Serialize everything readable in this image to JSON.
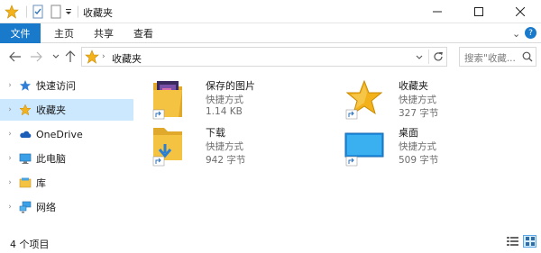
{
  "window": {
    "title": "收藏夹",
    "controls": [
      "minimize",
      "maximize",
      "close"
    ]
  },
  "ribbon": {
    "file_tab": "文件",
    "tabs": [
      "主页",
      "共享",
      "查看"
    ],
    "expand_label": "⌄",
    "help_label": "?"
  },
  "address": {
    "path": "收藏夹",
    "search_placeholder": "搜索\"收藏..."
  },
  "nav": {
    "items": [
      {
        "label": "快速访问",
        "icon": "quick-access-star-icon"
      },
      {
        "label": "收藏夹",
        "icon": "favorites-star-icon"
      },
      {
        "label": "OneDrive",
        "icon": "onedrive-cloud-icon"
      },
      {
        "label": "此电脑",
        "icon": "computer-monitor-icon"
      },
      {
        "label": "库",
        "icon": "library-icon"
      },
      {
        "label": "网络",
        "icon": "network-icon"
      }
    ],
    "selected_index": 1
  },
  "content": {
    "items": [
      {
        "name": "保存的图片",
        "type": "快捷方式",
        "size": "1.14 KB",
        "icon": "saved-pictures-folder-icon"
      },
      {
        "name": "收藏夹",
        "type": "快捷方式",
        "size": "327 字节",
        "icon": "favorites-star-icon"
      },
      {
        "name": "下载",
        "type": "快捷方式",
        "size": "942 字节",
        "icon": "downloads-folder-icon"
      },
      {
        "name": "桌面",
        "type": "快捷方式",
        "size": "509 字节",
        "icon": "desktop-icon"
      }
    ]
  },
  "status": {
    "item_count": "4 个项目"
  },
  "colors": {
    "accent": "#1979ca",
    "selection": "#cce8ff",
    "folder_yellow": "#f5c342",
    "star_gold": "#f3b21b"
  }
}
